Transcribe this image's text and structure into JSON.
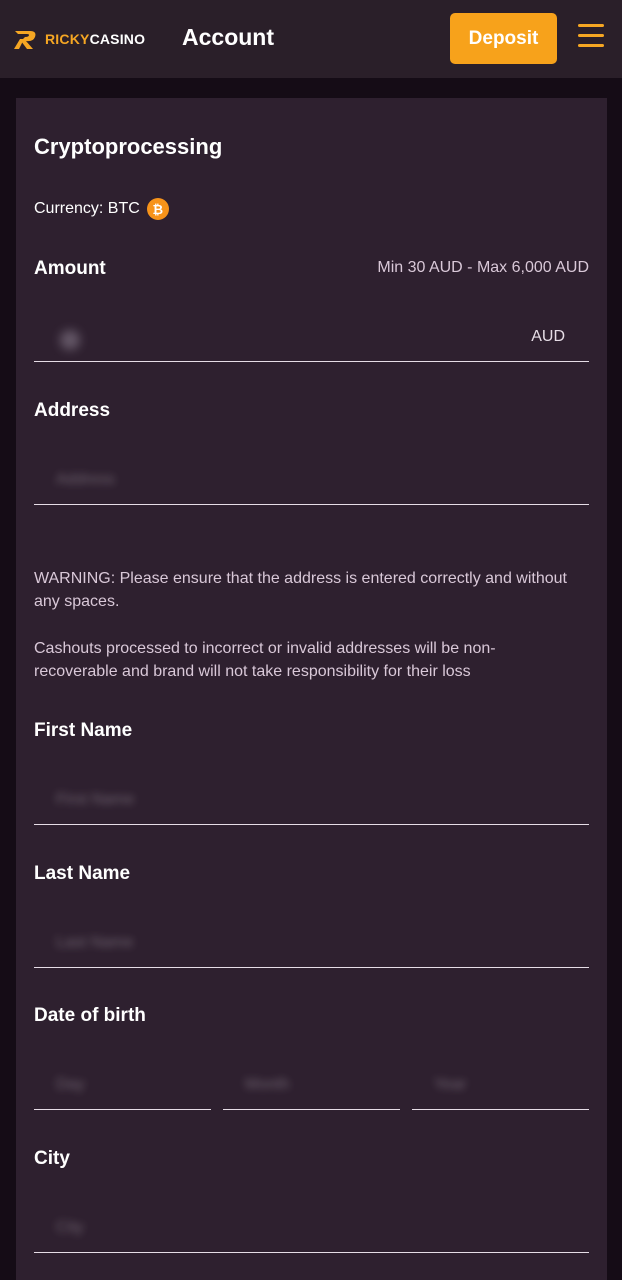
{
  "header": {
    "logo_part1": "RICKY",
    "logo_part2": "CASINO",
    "title": "Account",
    "deposit_label": "Deposit",
    "accent_color": "#f7a21b"
  },
  "form": {
    "title": "Cryptoprocessing",
    "currency_text": "Currency: BTC",
    "currency_icon": "bitcoin-icon",
    "amount": {
      "label": "Amount",
      "limits": "Min 30 AUD - Max 6,000 AUD",
      "suffix": "AUD"
    },
    "address": {
      "label": "Address",
      "placeholder": "Address"
    },
    "warning_1": "WARNING: Please ensure that the address is entered correctly and without any spaces.",
    "warning_2": "Cashouts processed to incorrect or invalid addresses will be non-recoverable and brand will not take responsibility for their loss",
    "first_name": {
      "label": "First Name",
      "placeholder": "First Name"
    },
    "last_name": {
      "label": "Last Name",
      "placeholder": "Last Name"
    },
    "dob": {
      "label": "Date of birth",
      "day_placeholder": "Day",
      "month_placeholder": "Month",
      "year_placeholder": "Year"
    },
    "city": {
      "label": "City",
      "placeholder": "City"
    }
  }
}
